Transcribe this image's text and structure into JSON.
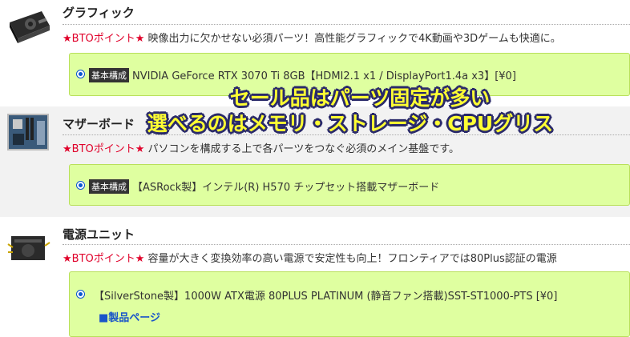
{
  "sections": {
    "graphic": {
      "heading": "グラフィック",
      "bto_tag": "★BTOポイント★",
      "description": "映像出力に欠かせない必須パーツ！高性能グラフィックで4K動画や3Dゲームも快適に。",
      "option": {
        "badge": "基本構成",
        "text": "NVIDIA GeForce RTX 3070 Ti 8GB【HDMI2.1 x1 / DisplayPort1.4a x3】[¥0]",
        "selected": true
      }
    },
    "motherboard": {
      "heading": "マザーボード",
      "bto_tag": "★BTOポイント★",
      "description": "パソコンを構成する上で各パーツをつなぐ必須のメイン基盤です。",
      "option": {
        "badge": "基本構成",
        "text": "【ASRock製】インテル(R) H570 チップセット搭載マザーボード",
        "selected": true
      }
    },
    "psu": {
      "heading": "電源ユニット",
      "bto_tag": "★BTOポイント★",
      "description": "容量が大きく変換効率の高い電源で安定性も向上！フロンティアでは80Plus認証の電源",
      "option": {
        "text": "【SilverStone製】1000W ATX電源 80PLUS PLATINUM (静音ファン搭載)SST-ST1000-PTS [¥0]",
        "selected": true,
        "product_link": "■製品ページ"
      }
    }
  },
  "overlay": {
    "line1": "セール品はパーツ固定が多い",
    "line2": "選べるのはメモリ・ストレージ・CPUグリス"
  },
  "colors": {
    "option_bg": "#dfffa0",
    "bto_red": "#e0002a",
    "link_blue": "#1a55c9",
    "overlay_yellow": "#ffff33"
  },
  "icons": {
    "graphic": "graphics-card-icon",
    "motherboard": "motherboard-icon",
    "psu": "power-supply-icon"
  }
}
